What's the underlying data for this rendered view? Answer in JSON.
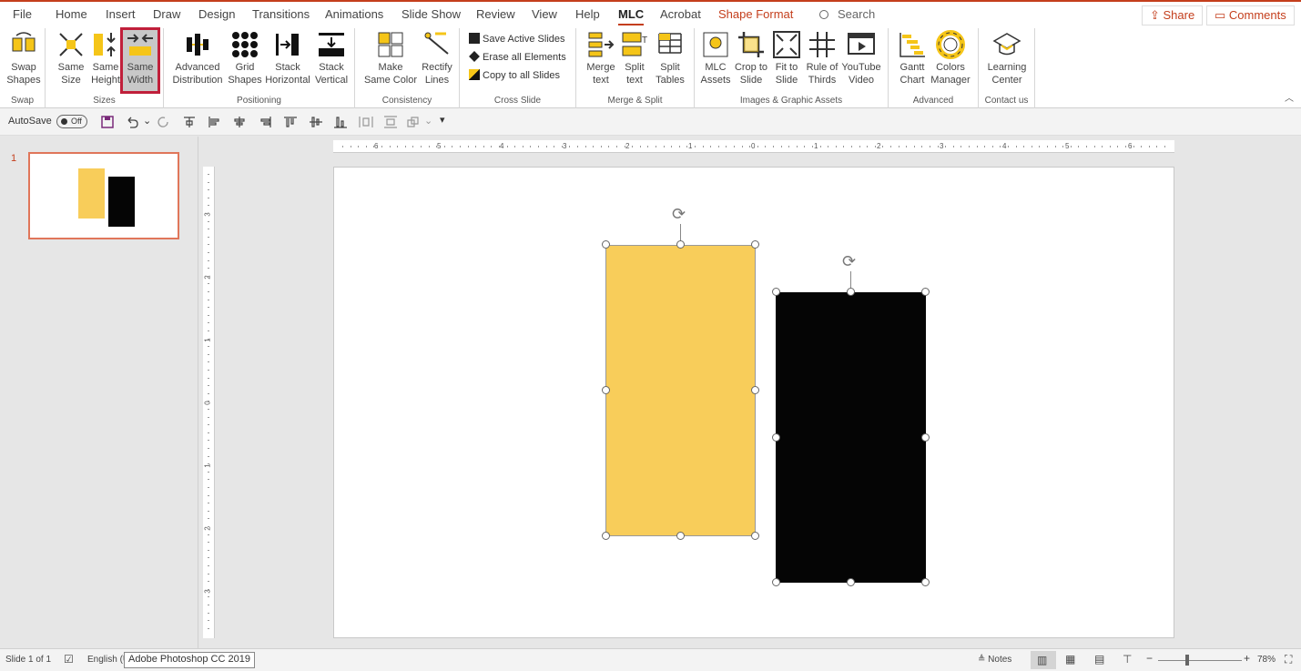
{
  "tabs": [
    "File",
    "Home",
    "Insert",
    "Draw",
    "Design",
    "Transitions",
    "Animations",
    "Slide Show",
    "Review",
    "View",
    "Help",
    "MLC",
    "Acrobat",
    "Shape Format"
  ],
  "search_label": "Search",
  "header_buttons": {
    "share": "Share",
    "comments": "Comments"
  },
  "ribbon": {
    "groups": {
      "swap": "Swap",
      "sizes": "Sizes",
      "positioning": "Positioning",
      "consistency": "Consistency",
      "cross_slide": "Cross Slide",
      "merge_split": "Merge & Split",
      "images": "Images & Graphic Assets",
      "advanced": "Advanced",
      "contact": "Contact us"
    },
    "buttons": {
      "swap_shapes": [
        "Swap",
        "Shapes"
      ],
      "same_size": [
        "Same",
        "Size"
      ],
      "same_height": [
        "Same",
        "Height"
      ],
      "same_width": [
        "Same",
        "Width"
      ],
      "advanced_distribution": [
        "Advanced",
        "Distribution"
      ],
      "grid_shapes": [
        "Grid",
        "Shapes"
      ],
      "stack_horizontal": [
        "Stack",
        "Horizontal"
      ],
      "stack_vertical": [
        "Stack",
        "Vertical"
      ],
      "make_same_color": [
        "Make",
        "Same Color"
      ],
      "rectify_lines": [
        "Rectify",
        "Lines"
      ],
      "merge_text": [
        "Merge",
        "text"
      ],
      "split_text": [
        "Split",
        "text"
      ],
      "split_tables": [
        "Split",
        "Tables"
      ],
      "mlc_assets": [
        "MLC",
        "Assets"
      ],
      "crop_to_slide": [
        "Crop to",
        "Slide"
      ],
      "fit_to_slide": [
        "Fit to",
        "Slide"
      ],
      "rule_of_thirds": [
        "Rule of",
        "Thirds"
      ],
      "youtube_video": [
        "YouTube",
        "Video"
      ],
      "gantt_chart": [
        "Gantt",
        "Chart"
      ],
      "colors_manager": [
        "Colors",
        "Manager"
      ],
      "learning_center": [
        "Learning",
        "Center"
      ]
    },
    "cross_slide_items": [
      "Save Active Slides",
      "Erase all Elements",
      "Copy to all Slides"
    ]
  },
  "qat": {
    "autosave": "AutoSave",
    "toggle": "Off"
  },
  "slide_number": "1",
  "ruler_h": [
    "6",
    "5",
    "4",
    "3",
    "2",
    "1",
    "0",
    "1",
    "2",
    "3",
    "4",
    "5",
    "6"
  ],
  "ruler_v": [
    "3",
    "2",
    "1",
    "0",
    "1",
    "2",
    "3"
  ],
  "shapes": {
    "yellow_color": "#f8cd5a",
    "black_color": "#050505"
  },
  "status": {
    "slide_info": "Slide 1 of 1",
    "language": "English (U",
    "tooltip": "Adobe Photoshop CC 2019",
    "notes": "Notes",
    "zoom_minus": "−",
    "zoom_plus": "+",
    "zoom": "78%"
  }
}
